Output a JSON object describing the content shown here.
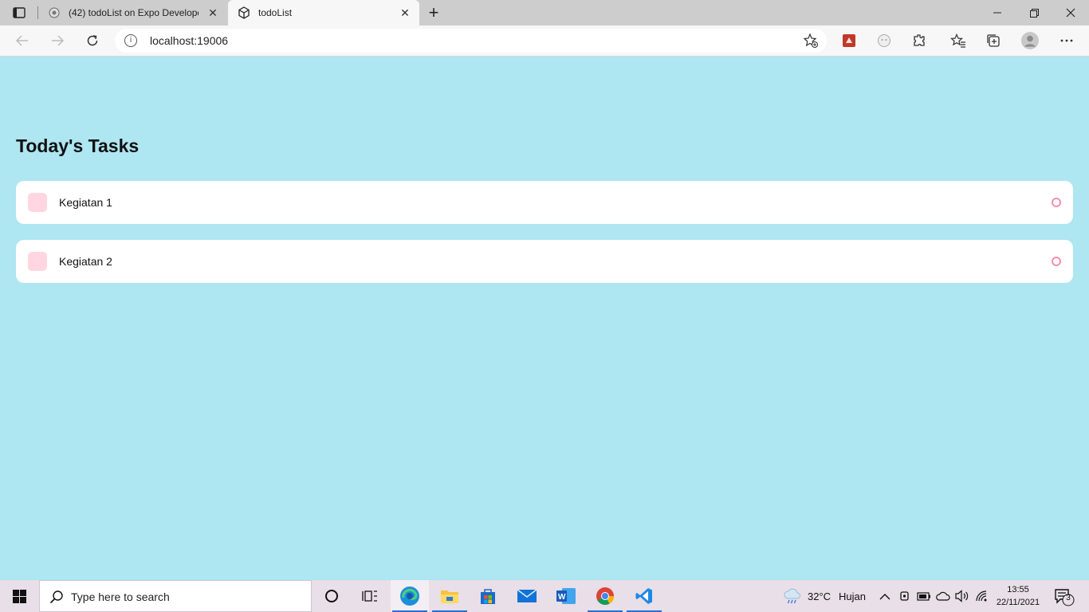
{
  "browser": {
    "tabs": [
      {
        "title": "(42) todoList on Expo Developer",
        "active": false
      },
      {
        "title": "todoList",
        "active": true
      }
    ],
    "address": {
      "url": "localhost:19006"
    },
    "window_controls": [
      "minimize",
      "restore",
      "close"
    ]
  },
  "app": {
    "heading": "Today's Tasks",
    "tasks": [
      {
        "label": "Kegiatan 1"
      },
      {
        "label": "Kegiatan 2"
      }
    ],
    "colors": {
      "background": "#aee6f2",
      "task_square": "#ffd6e2",
      "task_circle": "#f58fb0"
    }
  },
  "taskbar": {
    "search_placeholder": "Type here to search",
    "pinned": [
      "task-view",
      "edge",
      "file-explorer",
      "microsoft-store",
      "mail",
      "word",
      "chrome",
      "vscode"
    ],
    "weather": {
      "temp": "32°C",
      "condition": "Hujan"
    },
    "clock": {
      "time": "13:55",
      "date": "22/11/2021"
    },
    "notifications": "3"
  }
}
